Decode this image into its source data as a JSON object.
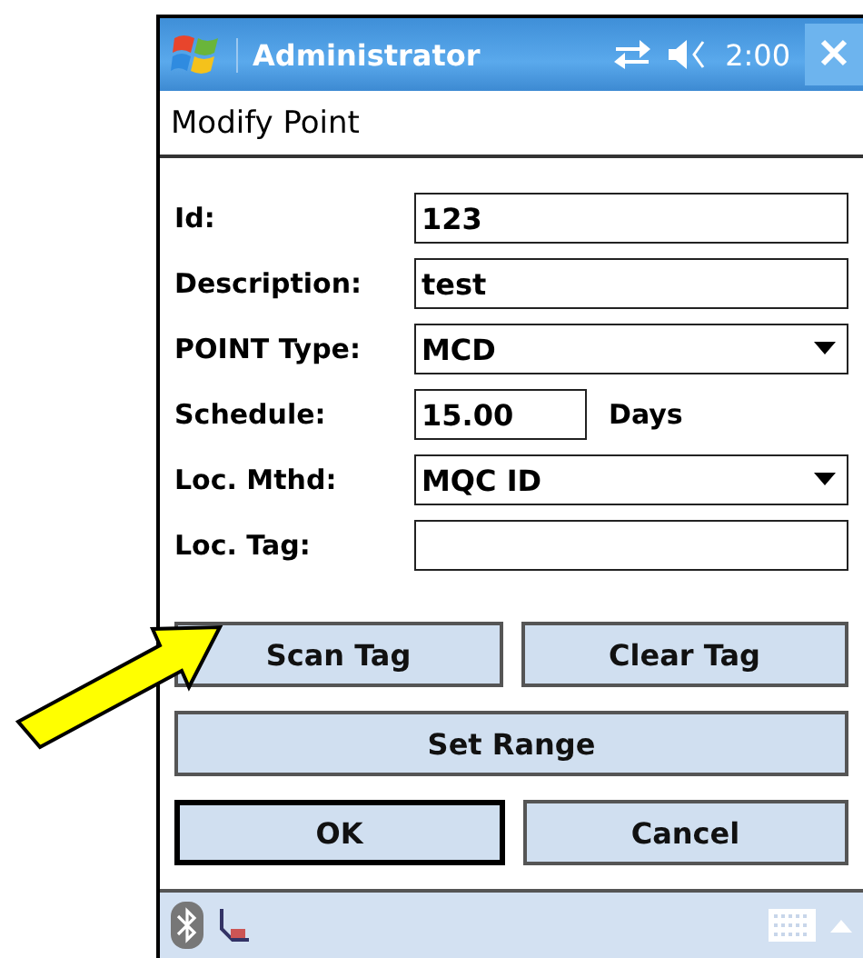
{
  "title_bar": {
    "title": "Administrator",
    "time": "2:00"
  },
  "form_title": "Modify Point",
  "fields": [
    {
      "kind": "text",
      "label": "Id:",
      "value": "123"
    },
    {
      "kind": "text",
      "label": "Description:",
      "value": "test"
    },
    {
      "kind": "dropdown",
      "label": "POINT Type:",
      "value": "MCD"
    },
    {
      "kind": "unit",
      "label": "Schedule:",
      "value": "15.00",
      "unit": "Days"
    },
    {
      "kind": "dropdown",
      "label": "Loc. Mthd:",
      "value": "MQC ID"
    },
    {
      "kind": "text",
      "label": "Loc. Tag:"
    }
  ],
  "button_rows": [
    [
      {
        "label": "Scan Tag",
        "default": false
      },
      {
        "label": "Clear Tag",
        "default": false
      }
    ],
    [
      {
        "label": "Set Range",
        "default": false
      }
    ],
    [
      {
        "label": "OK",
        "default": true
      },
      {
        "label": "Cancel",
        "default": false
      }
    ]
  ]
}
